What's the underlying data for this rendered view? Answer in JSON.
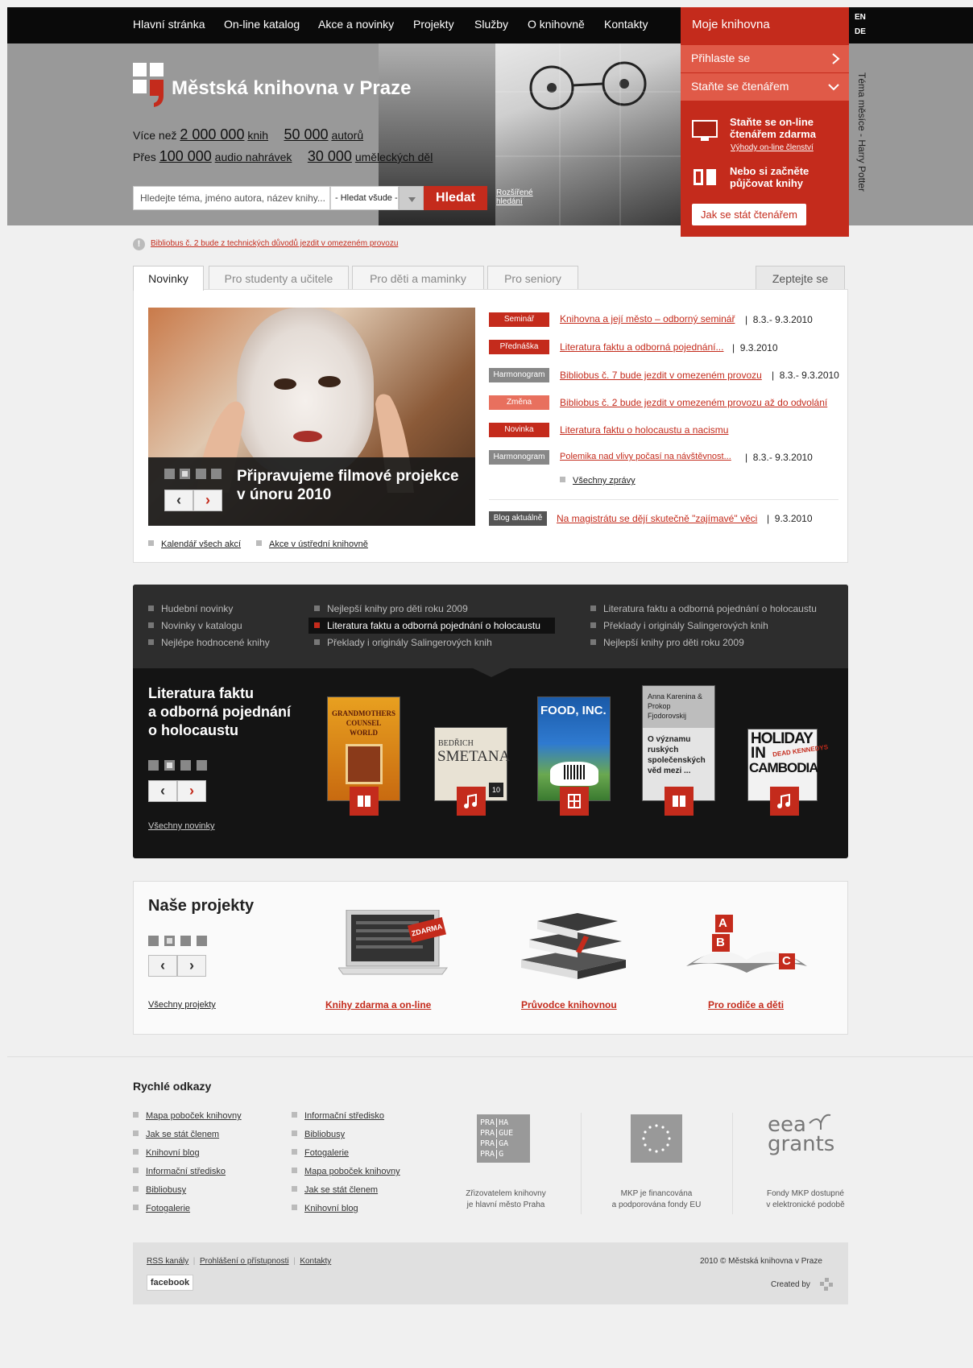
{
  "nav": {
    "items": [
      "Hlavní stránka",
      "On-line katalog",
      "Akce a novinky",
      "Projekty",
      "Služby",
      "O knihovně",
      "Kontakty"
    ],
    "active": "Hlavní stránka"
  },
  "langs": [
    "EN",
    "DE"
  ],
  "brand": {
    "name": "Městská knihovna v Praze"
  },
  "stats": {
    "line1_prefix": "Více než",
    "books_count": "2 000 000",
    "books_unit": "knih",
    "authors_count": "50 000",
    "authors_unit": "autorů",
    "line2_prefix": "Přes",
    "audio_count": "100 000",
    "audio_unit": "audio nahrávek",
    "works_count": "30 000",
    "works_unit": "uměleckých děl"
  },
  "search": {
    "placeholder": "Hledejte téma, jméno autora, název knihy...",
    "scope": "- Hledat všude -",
    "button": "Hledat",
    "advanced_line1": "Rozšířené",
    "advanced_line2": "hledání"
  },
  "moje": {
    "title": "Moje knihovna",
    "login": "Přihlaste se",
    "become": "Staňte se čtenářem",
    "online_title_1": "Staňte se on-line",
    "online_title_2": "čtenářem zdarma",
    "online_link": "Výhody on-line členství",
    "borrow_1": "Nebo si začněte",
    "borrow_2": "půjčovat knihy",
    "button": "Jak se stát čtenářem"
  },
  "theme_of_month": "Téma měsíce - Harry Potter",
  "notice": "Bibliobus č. 2 bude z technických důvodů jezdit v omezeném provozu",
  "tabs": [
    "Novinky",
    "Pro studenty a učitele",
    "Pro děti a maminky",
    "Pro seniory"
  ],
  "ask_tab": "Zeptejte se",
  "slider": {
    "title_1": "Připravujeme filmové projekce",
    "title_2": "v únoru 2010"
  },
  "news": [
    {
      "badge": "Seminář",
      "color": "#c42b1c",
      "title": "Knihovna a její město – odborný seminář",
      "date": "8.3.- 9.3.2010"
    },
    {
      "badge": "Přednáška",
      "color": "#c42b1c",
      "title": "Literatura faktu a odborná pojednání...",
      "date": "9.3.2010"
    },
    {
      "badge": "Harmonogram",
      "color": "#888888",
      "title": "Bibliobus č. 7 bude jezdit v omezeném provozu",
      "date": "8.3.- 9.3.2010"
    },
    {
      "badge": "Změna",
      "color": "#e8705e",
      "title": "Bibliobus č. 2 bude jezdit v omezeném provozu až do odvolání",
      "date": ""
    },
    {
      "badge": "Novinka",
      "color": "#c42b1c",
      "title": "Literatura faktu o holocaustu a nacismu",
      "date": ""
    },
    {
      "badge": "Harmonogram",
      "color": "#888888",
      "title": "Polemika nad vlivy počasí na návštěvnost...",
      "date": "8.3.- 9.3.2010"
    }
  ],
  "all_news": "Všechny zprávy",
  "blog": {
    "badge": "Blog aktuálně",
    "title": "Na magistrátu se dějí skutečně \"zajímavé\" věci",
    "date": "9.3.2010"
  },
  "panel_links": [
    "Kalendář všech akcí",
    "Akce v ústřední knihovně"
  ],
  "dark": {
    "links_col1": [
      "Hudební novinky",
      "Novinky v katalogu",
      "Nejlépe hodnocené knihy"
    ],
    "links_col2": [
      "Nejlepší knihy pro děti roku 2009",
      "Literatura faktu a odborná pojednání o holocaustu",
      "Překlady i originály Salingerových knih"
    ],
    "links_col3": [
      "Literatura faktu a odborná pojednání o holocaustu",
      "Překlady i originály Salingerových knih",
      "Nejlepší knihy pro děti roku 2009"
    ],
    "title_1": "Literatura faktu",
    "title_2": "a odborná pojednání",
    "title_3": "o holocaustu",
    "all_link": "Všechny novinky",
    "books": [
      {
        "cover_1": "GRANDMOTHERS",
        "cover_2": "COUNSEL",
        "cover_3": "WORLD",
        "icon": "book-icon"
      },
      {
        "cover_1": "BEDŘICH",
        "cover_2": "SMETANA",
        "cover_3": "10",
        "icon": "music-icon"
      },
      {
        "cover_1": "FOOD, INC.",
        "cover_2": "",
        "cover_3": "",
        "icon": "film-icon"
      },
      {
        "cover_1": "Anna Karenina &",
        "cover_2": "Prokop",
        "cover_3": "Fjodorovskij",
        "cover_4": "O významu ruských společenských věd mezi ...",
        "icon": "book-icon"
      },
      {
        "cover_1": "HOLIDAY",
        "cover_2": "IN",
        "cover_3": "CAMBODIA",
        "cover_4": "DEAD KENNEDYS",
        "icon": "music-icon"
      }
    ]
  },
  "projects": {
    "title": "Naše projekty",
    "all_link": "Všechny projekty",
    "items": [
      "Knihy zdarma a on-line",
      "Průvodce knihovnou",
      "Pro rodiče a děti"
    ],
    "badge": "ZDARMA",
    "blocks": [
      "A",
      "B",
      "C"
    ]
  },
  "quick": {
    "title": "Rychlé odkazy",
    "col1": [
      "Mapa poboček knihovny",
      "Jak se stát členem",
      "Knihovní blog",
      "Informační středisko",
      "Bibliobusy",
      "Fotogalerie"
    ],
    "col2": [
      "Informační středisko",
      "Bibliobusy",
      "Fotogalerie",
      "Mapa poboček knihovny",
      "Jak se stát členem",
      "Knihovní blog"
    ]
  },
  "sponsors": {
    "praha_logo": [
      "PRA",
      "HA",
      "PRA",
      "GUE",
      "PRA",
      "GA",
      "PRA",
      "G"
    ],
    "praha_1": "Zřizovatelem knihovny",
    "praha_2": "je hlavní město Praha",
    "eu_1": "MKP je financována",
    "eu_2": "a podporována fondy EU",
    "eea_logo_1": "eea",
    "eea_logo_2": "grants",
    "eea_1": "Fondy MKP dostupné",
    "eea_2": "v elektronické podobě"
  },
  "footer": {
    "links": [
      "RSS kanály",
      "Prohlášení o přístupnosti",
      "Kontakty"
    ],
    "copyright": "2010 © Městská knihovna v Praze",
    "created_by": "Created by",
    "facebook": "facebook"
  },
  "colors": {
    "accent": "#c42b1c",
    "accent_light": "#e05a48",
    "dark": "#141414"
  }
}
